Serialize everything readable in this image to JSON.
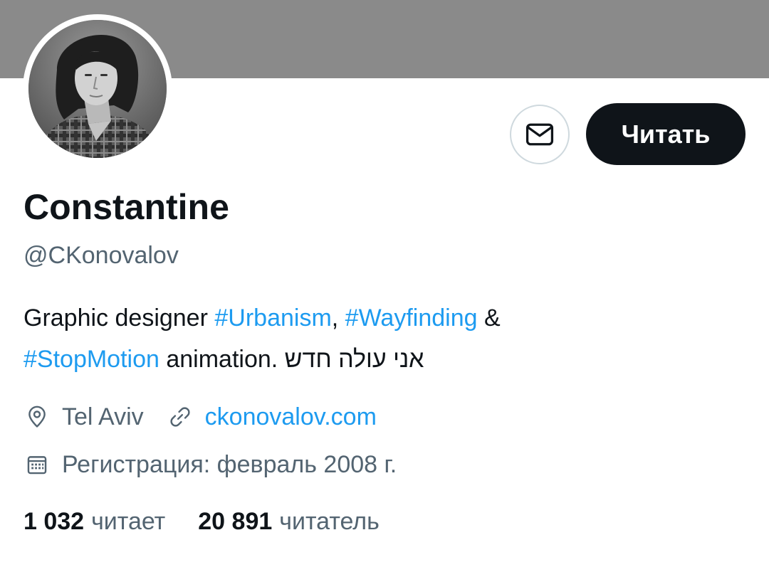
{
  "profile": {
    "display_name": "Constantine",
    "handle": "@CKonovalov",
    "avatar_icon": "user-photo",
    "bio": {
      "text_1": "Graphic designer ",
      "tag_urbanism": "#Urbanism",
      "text_2": ", ",
      "tag_wayfinding": "#Wayfinding",
      "text_3": " &",
      "tag_stopmotion": "#StopMotion",
      "text_4": " animation. ",
      "hebrew": "אני עולה חדש"
    },
    "location": "Tel Aviv",
    "website": "ckonovalov.com",
    "joined": "Регистрация: февраль 2008 г."
  },
  "actions": {
    "message_icon": "envelope-icon",
    "follow_label": "Читать"
  },
  "stats": {
    "following_count": "1 032",
    "following_label": "читает",
    "followers_count": "20 891",
    "followers_label": "читатель"
  },
  "colors": {
    "banner": "#8a8a8a",
    "accent": "#1d9bf0",
    "text_primary": "#0f1419",
    "text_secondary": "#536471",
    "follow_bg": "#0f1419"
  }
}
